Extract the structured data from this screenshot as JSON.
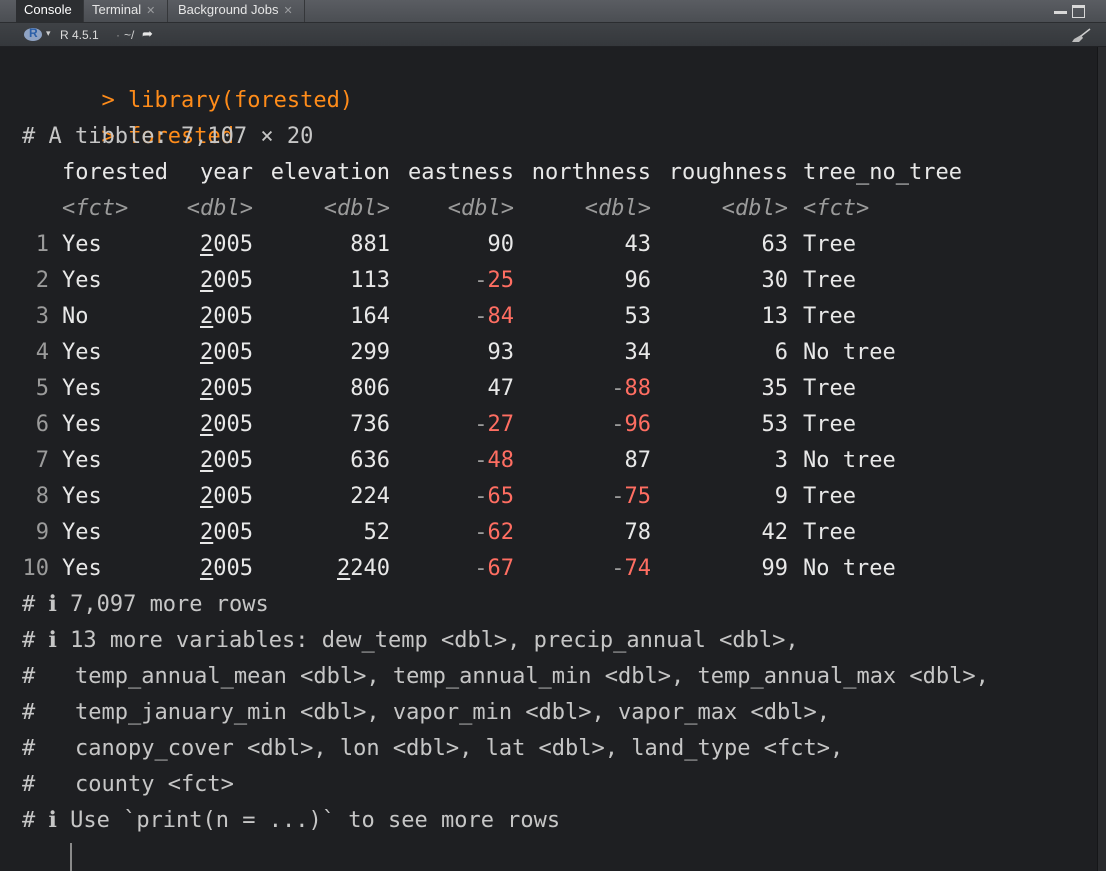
{
  "tabs": [
    {
      "label": "Console",
      "closable": false
    },
    {
      "label": "Terminal",
      "closable": true
    },
    {
      "label": "Background Jobs",
      "closable": true
    }
  ],
  "path_bar": {
    "r_version": "R 4.5.1",
    "separator": "·",
    "working_dir": "~/"
  },
  "console": {
    "prompt": ">",
    "commands": [
      "library(forested)",
      "forested"
    ],
    "tibble_header": "# A tibble: 7,107 × 20",
    "columns": [
      "forested",
      "year",
      "elevation",
      "eastness",
      "northness",
      "roughness",
      "tree_no_tree"
    ],
    "column_types": [
      "<fct>",
      "<dbl>",
      "<dbl>",
      "<dbl>",
      "<dbl>",
      "<dbl>",
      "<fct>"
    ],
    "rows": [
      {
        "idx": "1",
        "forested": "Yes",
        "year": "2005",
        "elevation": "881",
        "eastness": "90",
        "northness": "43",
        "roughness": "63",
        "tree_no_tree": "Tree"
      },
      {
        "idx": "2",
        "forested": "Yes",
        "year": "2005",
        "elevation": "113",
        "eastness": "-25",
        "northness": "96",
        "roughness": "30",
        "tree_no_tree": "Tree"
      },
      {
        "idx": "3",
        "forested": "No",
        "year": "2005",
        "elevation": "164",
        "eastness": "-84",
        "northness": "53",
        "roughness": "13",
        "tree_no_tree": "Tree"
      },
      {
        "idx": "4",
        "forested": "Yes",
        "year": "2005",
        "elevation": "299",
        "eastness": "93",
        "northness": "34",
        "roughness": "6",
        "tree_no_tree": "No tree"
      },
      {
        "idx": "5",
        "forested": "Yes",
        "year": "2005",
        "elevation": "806",
        "eastness": "47",
        "northness": "-88",
        "roughness": "35",
        "tree_no_tree": "Tree"
      },
      {
        "idx": "6",
        "forested": "Yes",
        "year": "2005",
        "elevation": "736",
        "eastness": "-27",
        "northness": "-96",
        "roughness": "53",
        "tree_no_tree": "Tree"
      },
      {
        "idx": "7",
        "forested": "Yes",
        "year": "2005",
        "elevation": "636",
        "eastness": "-48",
        "northness": "87",
        "roughness": "3",
        "tree_no_tree": "No tree"
      },
      {
        "idx": "8",
        "forested": "Yes",
        "year": "2005",
        "elevation": "224",
        "eastness": "-65",
        "northness": "-75",
        "roughness": "9",
        "tree_no_tree": "Tree"
      },
      {
        "idx": "9",
        "forested": "Yes",
        "year": "2005",
        "elevation": "52",
        "eastness": "-62",
        "northness": "78",
        "roughness": "42",
        "tree_no_tree": "Tree"
      },
      {
        "idx": "10",
        "forested": "Yes",
        "year": "2005",
        "elevation": "2240",
        "eastness": "-67",
        "northness": "-74",
        "roughness": "99",
        "tree_no_tree": "No tree"
      }
    ],
    "footer_lines": [
      "# ℹ 7,097 more rows",
      "# ℹ 13 more variables: dew_temp <dbl>, precip_annual <dbl>,",
      "#   temp_annual_mean <dbl>, temp_annual_min <dbl>, temp_annual_max <dbl>,",
      "#   temp_january_min <dbl>, vapor_min <dbl>, vapor_max <dbl>,",
      "#   canopy_cover <dbl>, lon <dbl>, lat <dbl>, land_type <fct>,",
      "#   county <fct>",
      "# ℹ Use `print(n = ...)` to see more rows"
    ]
  },
  "colors": {
    "background": "#1e1f22",
    "command": "#ff8c1a",
    "negative": "#ff6e62",
    "type_hint": "#9b9b9b"
  }
}
